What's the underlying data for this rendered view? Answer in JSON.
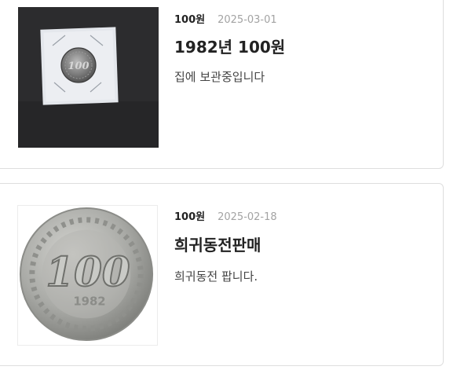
{
  "listings": [
    {
      "price": "100원",
      "date": "2025-03-01",
      "title": "1982년 100원",
      "description": "집에 보관중입니다",
      "image": "coin-in-holder-photo",
      "coin_text": "100"
    },
    {
      "price": "100원",
      "date": "2025-02-18",
      "title": "희귀동전판매",
      "description": "희귀동전 팝니다.",
      "image": "coin-closeup-photo",
      "coin_text": "100",
      "coin_year": "1982"
    }
  ],
  "colors": {
    "card_border": "#dedede",
    "title_text": "#222222",
    "date_text": "#a3a3a3",
    "body_text": "#444444"
  }
}
